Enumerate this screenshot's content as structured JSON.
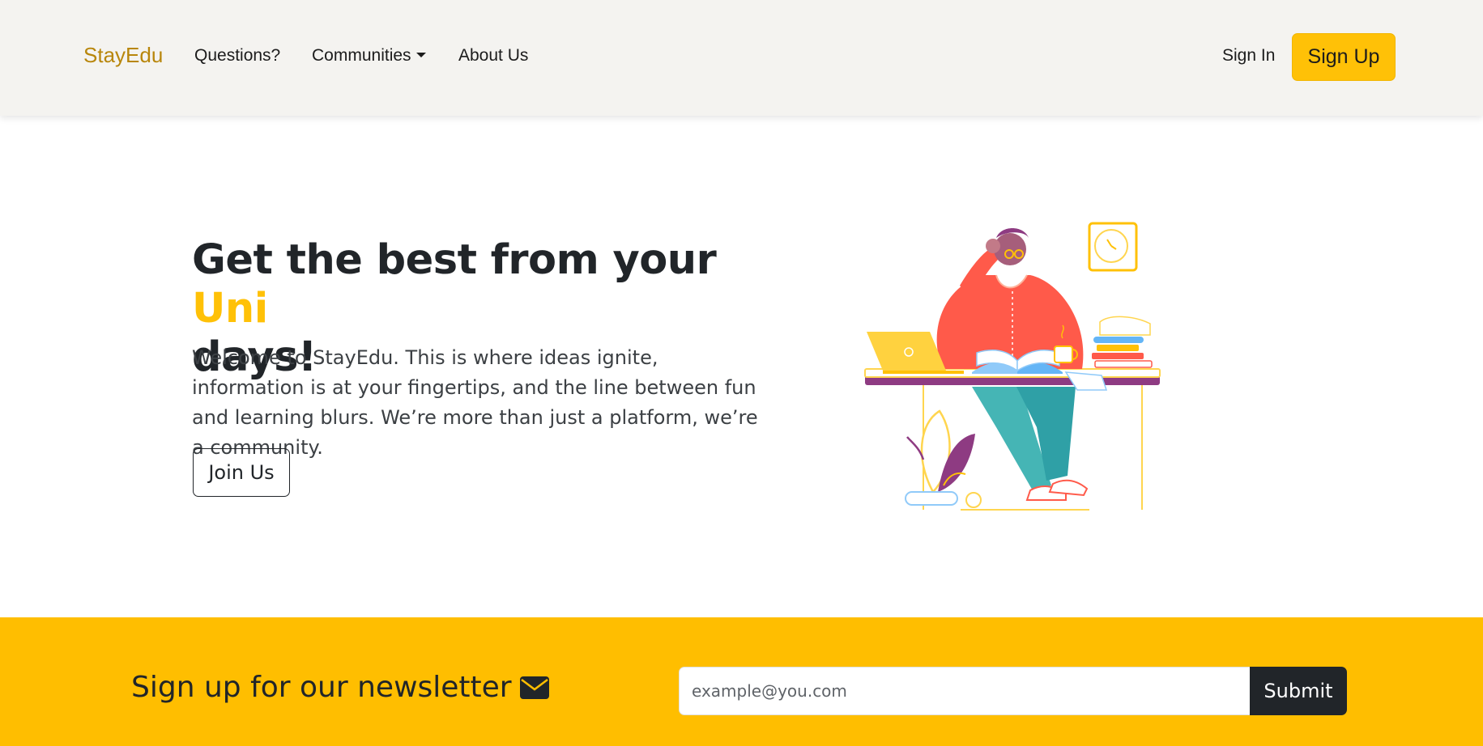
{
  "nav": {
    "brand": "StayEdu",
    "links": [
      "Questions?",
      "Communities",
      "About Us"
    ],
    "sign_in": "Sign In",
    "sign_up": "Sign Up"
  },
  "hero": {
    "title_part1": "Get the best from your ",
    "title_highlight": "Uni",
    "title_part2": "days!",
    "description": "Welcome to StayEdu. This is where ideas ignite, information is at your fingertips, and the line between fun and learning blurs. We’re more than just a platform, we’re a community.",
    "join_button": "Join Us",
    "illustration_icon": "student-at-desk-illustration"
  },
  "newsletter": {
    "title": "Sign up for our newsletter",
    "icon": "envelope-icon",
    "email_placeholder": "example@you.com",
    "email_value": "",
    "submit_label": "Submit"
  },
  "colors": {
    "accent": "#ffc107",
    "newsletter_bg": "#ffbe00",
    "navbar_bg": "#f4f3f0",
    "brand": "#b8860b",
    "dark": "#212529"
  }
}
